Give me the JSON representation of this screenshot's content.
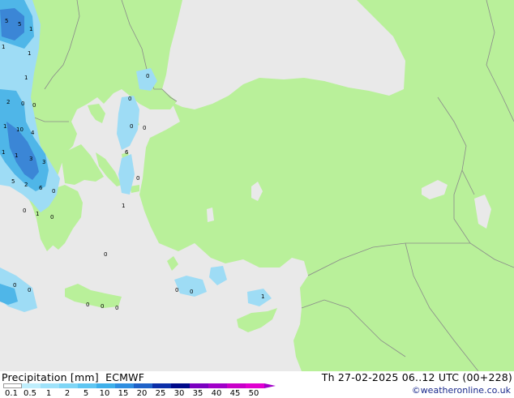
{
  "map": {
    "colors": {
      "sea": "#e9e9e9",
      "land": "#b9f09a",
      "border": "#8a8a8a",
      "precip_light": "#9edcf5",
      "precip_mid": "#4fb6e8",
      "precip_heavy": "#3b86d6"
    },
    "point_values": [
      {
        "id": "v1",
        "text": "5"
      },
      {
        "id": "v2",
        "text": "5"
      },
      {
        "id": "v3",
        "text": "1"
      },
      {
        "id": "v4",
        "text": "1"
      },
      {
        "id": "v5",
        "text": "1"
      },
      {
        "id": "v6",
        "text": "1"
      },
      {
        "id": "v7",
        "text": "0"
      },
      {
        "id": "v8",
        "text": "2"
      },
      {
        "id": "v9",
        "text": "0"
      },
      {
        "id": "v10",
        "text": "1"
      },
      {
        "id": "v11",
        "text": "10"
      },
      {
        "id": "v12",
        "text": "4"
      },
      {
        "id": "v13",
        "text": "1"
      },
      {
        "id": "v14",
        "text": "1"
      },
      {
        "id": "v15",
        "text": "3"
      },
      {
        "id": "v16",
        "text": "3"
      },
      {
        "id": "v17",
        "text": "5"
      },
      {
        "id": "v18",
        "text": "2"
      },
      {
        "id": "v19",
        "text": "6"
      },
      {
        "id": "v20",
        "text": "0"
      },
      {
        "id": "v21",
        "text": "0"
      },
      {
        "id": "v22",
        "text": "1"
      },
      {
        "id": "v23",
        "text": "0"
      },
      {
        "id": "v24",
        "text": "0"
      },
      {
        "id": "v25",
        "text": "0"
      },
      {
        "id": "v26",
        "text": "0"
      },
      {
        "id": "v27",
        "text": "6"
      },
      {
        "id": "v28",
        "text": "0"
      },
      {
        "id": "v29",
        "text": "1"
      },
      {
        "id": "v30",
        "text": "0"
      },
      {
        "id": "v31",
        "text": "0"
      },
      {
        "id": "v32",
        "text": "0"
      },
      {
        "id": "v33",
        "text": "0"
      },
      {
        "id": "v34",
        "text": "0"
      },
      {
        "id": "v35",
        "text": "0"
      },
      {
        "id": "v36",
        "text": "0"
      },
      {
        "id": "v37",
        "text": "0"
      },
      {
        "id": "v38",
        "text": "1"
      },
      {
        "id": "v39",
        "text": "0"
      }
    ]
  },
  "legend": {
    "title": "Precipitation [mm]  ECMWF",
    "validity": "Th 27-02-2025 06..12 UTC (00+228)",
    "credit": "©weatheronline.co.uk",
    "levels": [
      "0.1",
      "0.5",
      "1",
      "2",
      "5",
      "10",
      "15",
      "20",
      "25",
      "30",
      "35",
      "40",
      "45",
      "50"
    ],
    "colors": [
      "#ffffff",
      "#bfeefc",
      "#9fe2fa",
      "#7fd6f6",
      "#5fc6f2",
      "#3fb0ea",
      "#2f8ee0",
      "#1f62c8",
      "#0c2fa8",
      "#000a8a",
      "#7a00c0",
      "#a000c8",
      "#c800c8",
      "#e000d0"
    ]
  }
}
